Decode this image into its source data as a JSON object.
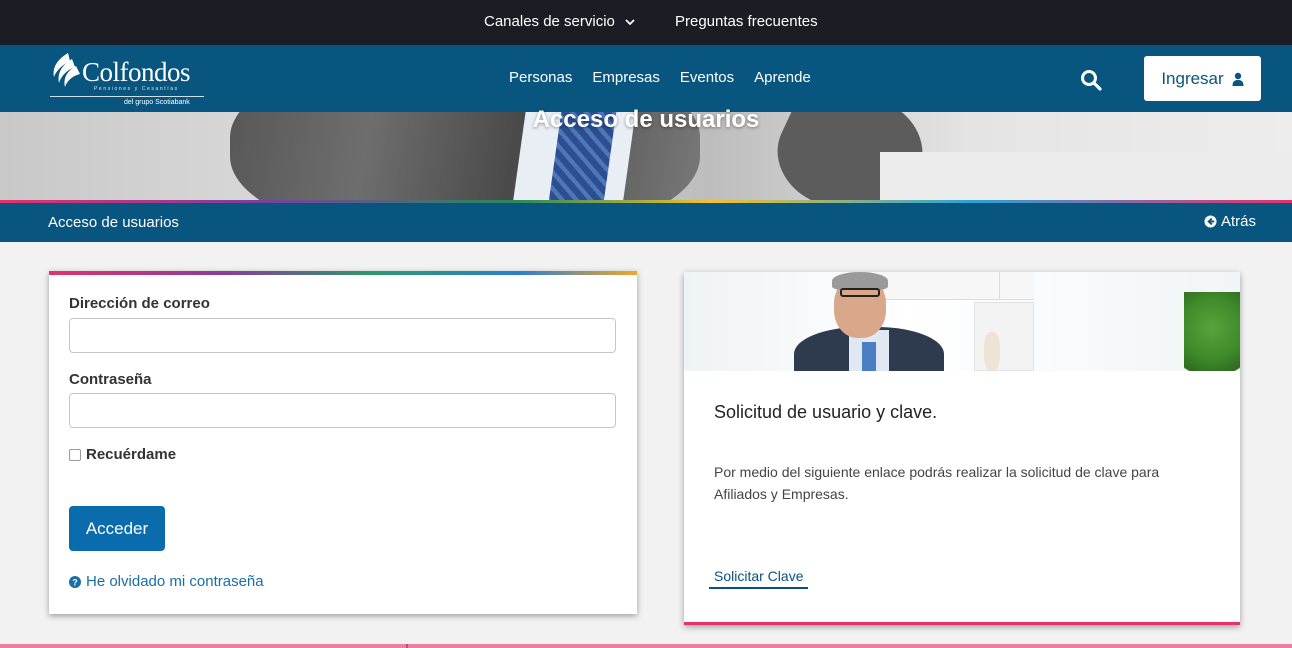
{
  "topbar": {
    "canales": "Canales de servicio",
    "faq": "Preguntas frecuentes"
  },
  "header": {
    "logo_name": "Colfondos",
    "logo_tagline": "Pensiones y Cesantías",
    "logo_sub": "del grupo Scotiabank",
    "nav": [
      "Personas",
      "Empresas",
      "Eventos",
      "Aprende"
    ],
    "ingresar": "Ingresar"
  },
  "hero": {
    "title": "Acceso de usuarios"
  },
  "breadcrumb": {
    "current": "Acceso de usuarios",
    "back": "Atrás"
  },
  "login": {
    "email_label": "Dirección de correo",
    "email_value": "",
    "password_label": "Contraseña",
    "password_value": "",
    "remember_label": "Recuérdame",
    "submit": "Acceder",
    "forgot": "He olvidado mi contraseña"
  },
  "info": {
    "title": "Solicitud de usuario y clave.",
    "text": "Por medio del siguiente enlace podrás realizar la solicitud de clave para Afiliados y Empresas.",
    "link": "Solicitar Clave"
  },
  "colors": {
    "topbar": "#1c1d24",
    "brand": "#08557f",
    "button": "#0b6cad",
    "accent_pink": "#e5316c"
  },
  "icons": [
    "chevron-down-icon",
    "colfondos-logo-icon",
    "search-icon",
    "user-icon",
    "arrow-left-circle-icon",
    "question-circle-icon"
  ]
}
